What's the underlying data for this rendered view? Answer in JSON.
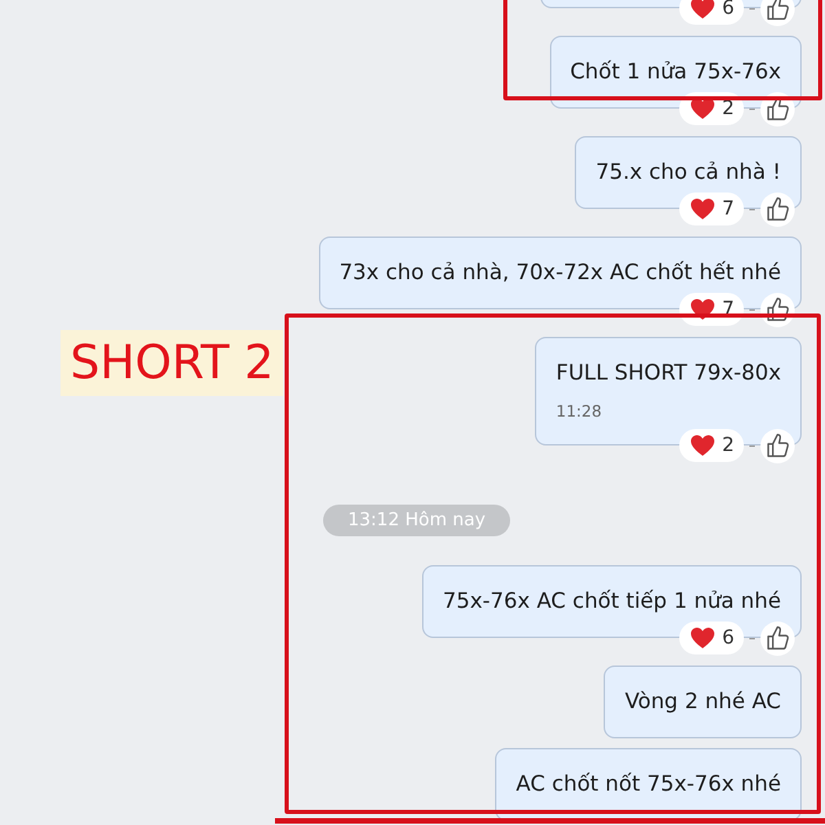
{
  "messages": [
    {
      "kind": "cut",
      "reaction": {
        "count": "6"
      }
    },
    {
      "kind": "text",
      "text": "Chốt 1 nửa 75x-76x",
      "reaction": {
        "count": "2"
      }
    },
    {
      "kind": "text",
      "text": "75.x cho cả nhà !",
      "reaction": {
        "count": "7"
      }
    },
    {
      "kind": "text",
      "text": "73x cho cả nhà, 70x-72x AC chốt hết nhé",
      "reaction": {
        "count": "7"
      }
    },
    {
      "kind": "text",
      "text": "FULL SHORT 79x-80x",
      "time": "11:28",
      "reaction": {
        "count": "2"
      }
    },
    {
      "kind": "date",
      "text": "13:12 Hôm nay"
    },
    {
      "kind": "text",
      "text": "75x-76x AC chốt tiếp 1 nửa nhé",
      "reaction": {
        "count": "6"
      }
    },
    {
      "kind": "text",
      "text": "Vòng 2 nhé AC"
    },
    {
      "kind": "text",
      "text": "AC chốt nốt 75x-76x nhé"
    }
  ],
  "annotation": {
    "label": "SHORT 2"
  }
}
